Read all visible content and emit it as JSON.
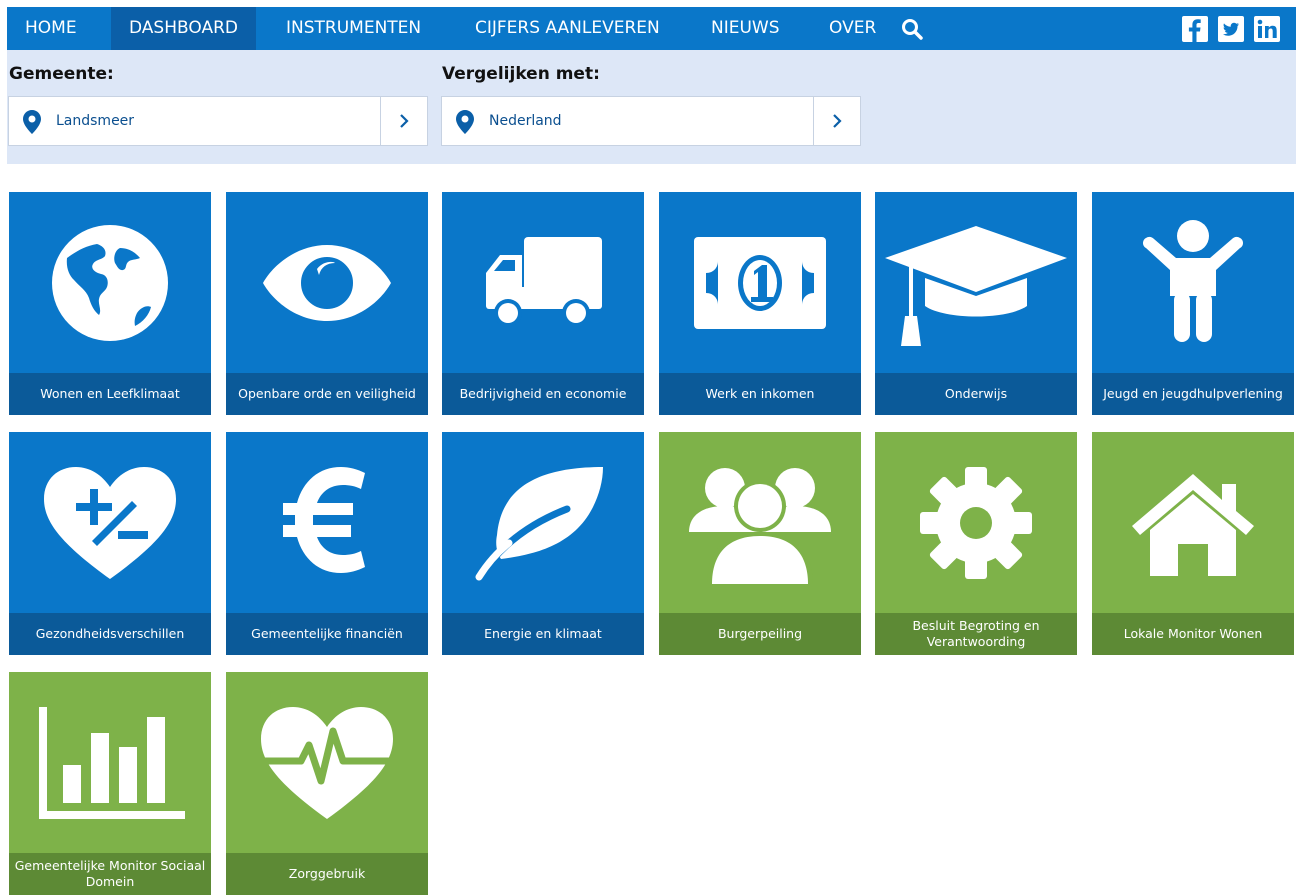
{
  "nav": {
    "items": [
      "HOME",
      "DASHBOARD",
      "INSTRUMENTEN",
      "CIJFERS AANLEVEREN",
      "NIEUWS",
      "OVER"
    ],
    "active": "DASHBOARD",
    "search_icon": "search-icon",
    "social_icons": [
      "facebook-icon",
      "twitter-icon",
      "linkedin-icon"
    ]
  },
  "filters": {
    "gemeente_label": "Gemeente:",
    "gemeente_value": "Landsmeer",
    "vergelijk_label": "Vergelijken met:",
    "vergelijk_value": "Nederland"
  },
  "tiles": [
    {
      "label": "Wonen en Leefklimaat",
      "color": "blue",
      "icon": "globe-icon"
    },
    {
      "label": "Openbare orde en veiligheid",
      "color": "blue",
      "icon": "eye-icon"
    },
    {
      "label": "Bedrijvigheid en economie",
      "color": "blue",
      "icon": "truck-icon"
    },
    {
      "label": "Werk en inkomen",
      "color": "blue",
      "icon": "banknote-icon"
    },
    {
      "label": "Onderwijs",
      "color": "blue",
      "icon": "graduation-cap-icon"
    },
    {
      "label": "Jeugd en jeugdhulpverlening",
      "color": "blue",
      "icon": "child-icon"
    },
    {
      "label": "Gezondheidsverschillen",
      "color": "blue",
      "icon": "heart-plus-minus-icon"
    },
    {
      "label": "Gemeentelijke financiën",
      "color": "blue",
      "icon": "euro-icon"
    },
    {
      "label": "Energie en klimaat",
      "color": "blue",
      "icon": "leaf-icon"
    },
    {
      "label": "Burgerpeiling",
      "color": "green",
      "icon": "group-icon"
    },
    {
      "label": "Besluit Begroting en Verantwoording",
      "color": "green",
      "icon": "gear-icon"
    },
    {
      "label": "Lokale Monitor Wonen",
      "color": "green",
      "icon": "house-icon"
    },
    {
      "label": "Gemeentelijke Monitor Sociaal Domein",
      "color": "green",
      "icon": "bar-chart-icon"
    },
    {
      "label": "Zorggebruik",
      "color": "green",
      "icon": "heartbeat-icon"
    }
  ],
  "colors": {
    "nav_blue": "#0a77c9",
    "nav_active": "#0b5fa8",
    "tile_blue": "#0a77c9",
    "tile_blue_label": "#0b5a99",
    "tile_green": "#7eb249",
    "tile_green_label": "#5d8a35",
    "filter_bg": "#dde7f7"
  }
}
